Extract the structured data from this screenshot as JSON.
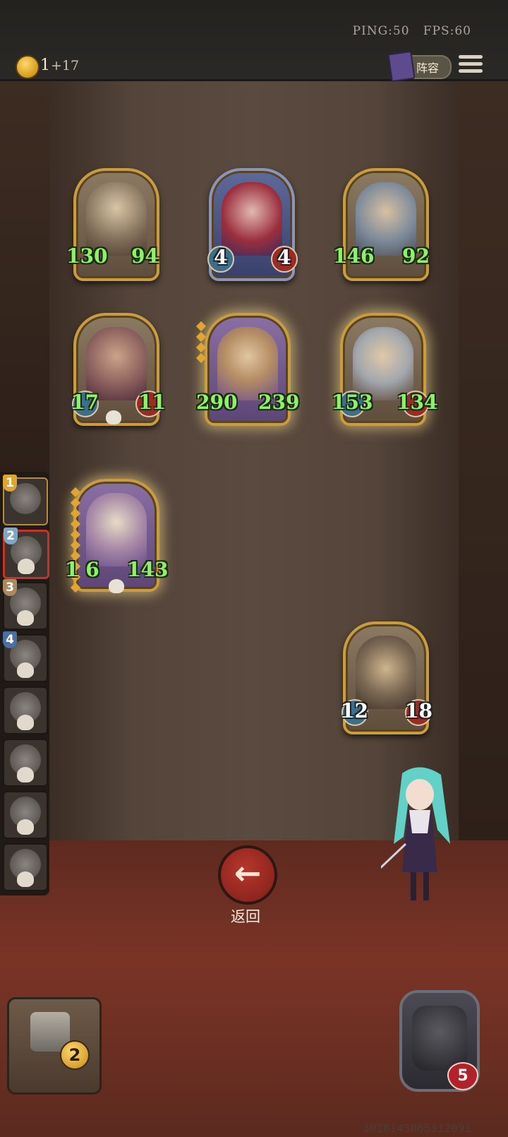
{
  "hud": {
    "ping_label": "PING:50",
    "fps_label": "FPS:60",
    "gold": "1",
    "gold_income": "+17",
    "lineup_label": "阵容"
  },
  "board": {
    "cards": [
      {
        "attack": "130",
        "health": "94"
      },
      {
        "attack": "4",
        "health": "4"
      },
      {
        "attack": "146",
        "health": "92"
      },
      {
        "attack": "17",
        "health": "11"
      },
      {
        "attack": "290",
        "health": "239"
      },
      {
        "attack": "153",
        "health": "134"
      },
      {
        "attack": "1 6",
        "health": "143"
      },
      {
        "attack": "12",
        "health": "18"
      }
    ]
  },
  "sidebar": {
    "ranks": [
      "1",
      "2",
      "3",
      "4"
    ]
  },
  "back_button": {
    "label": "返回"
  },
  "shop": {
    "level": "2"
  },
  "hero": {
    "health": "5"
  },
  "player_id": "3018143865312091"
}
